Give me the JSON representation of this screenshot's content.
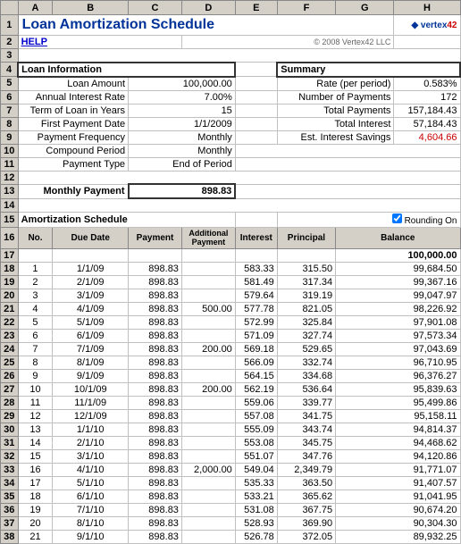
{
  "title": "Loan Amortization Schedule",
  "logo": "© 2008 Vertex42 LLC",
  "help_link": "HELP",
  "loan_info": {
    "header": "Loan Information",
    "fields": [
      {
        "label": "Loan Amount",
        "value": "100,000.00"
      },
      {
        "label": "Annual Interest Rate",
        "value": "7.00%"
      },
      {
        "label": "Term of Loan in Years",
        "value": "15"
      },
      {
        "label": "First Payment Date",
        "value": "1/1/2009"
      },
      {
        "label": "Payment Frequency",
        "value": "Monthly"
      },
      {
        "label": "Compound Period",
        "value": "Monthly"
      },
      {
        "label": "Payment Type",
        "value": "End of Period"
      }
    ]
  },
  "summary": {
    "header": "Summary",
    "fields": [
      {
        "label": "Rate (per period)",
        "value": "0.583%"
      },
      {
        "label": "Number of Payments",
        "value": "172"
      },
      {
        "label": "Total Payments",
        "value": "157,184.43"
      },
      {
        "label": "Total Interest",
        "value": "57,184.43"
      },
      {
        "label": "Est. Interest Savings",
        "value": "4,604.66"
      }
    ]
  },
  "monthly_payment_label": "Monthly Payment",
  "monthly_payment_value": "898.83",
  "rounding_label": "Rounding On",
  "amort_header": "Amortization Schedule",
  "col_headers": [
    "No.",
    "Due Date",
    "Payment",
    "Additional\nPayment",
    "Interest",
    "Principal",
    "Balance"
  ],
  "col_letters": [
    "A",
    "B",
    "C",
    "D",
    "E",
    "F",
    "G",
    "H"
  ],
  "rows": [
    {
      "row": 17,
      "no": "",
      "date": "",
      "payment": "",
      "add_payment": "",
      "interest": "",
      "principal": "",
      "balance": "100,000.00"
    },
    {
      "row": 18,
      "no": "1",
      "date": "1/1/09",
      "payment": "898.83",
      "add_payment": "",
      "interest": "583.33",
      "principal": "315.50",
      "balance": "99,684.50"
    },
    {
      "row": 19,
      "no": "2",
      "date": "2/1/09",
      "payment": "898.83",
      "add_payment": "",
      "interest": "581.49",
      "principal": "317.34",
      "balance": "99,367.16"
    },
    {
      "row": 20,
      "no": "3",
      "date": "3/1/09",
      "payment": "898.83",
      "add_payment": "",
      "interest": "579.64",
      "principal": "319.19",
      "balance": "99,047.97"
    },
    {
      "row": 21,
      "no": "4",
      "date": "4/1/09",
      "payment": "898.83",
      "add_payment": "500.00",
      "interest": "577.78",
      "principal": "821.05",
      "balance": "98,226.92"
    },
    {
      "row": 22,
      "no": "5",
      "date": "5/1/09",
      "payment": "898.83",
      "add_payment": "",
      "interest": "572.99",
      "principal": "325.84",
      "balance": "97,901.08"
    },
    {
      "row": 23,
      "no": "6",
      "date": "6/1/09",
      "payment": "898.83",
      "add_payment": "",
      "interest": "571.09",
      "principal": "327.74",
      "balance": "97,573.34"
    },
    {
      "row": 24,
      "no": "7",
      "date": "7/1/09",
      "payment": "898.83",
      "add_payment": "200.00",
      "interest": "569.18",
      "principal": "529.65",
      "balance": "97,043.69"
    },
    {
      "row": 25,
      "no": "8",
      "date": "8/1/09",
      "payment": "898.83",
      "add_payment": "",
      "interest": "566.09",
      "principal": "332.74",
      "balance": "96,710.95"
    },
    {
      "row": 26,
      "no": "9",
      "date": "9/1/09",
      "payment": "898.83",
      "add_payment": "",
      "interest": "564.15",
      "principal": "334.68",
      "balance": "96,376.27"
    },
    {
      "row": 27,
      "no": "10",
      "date": "10/1/09",
      "payment": "898.83",
      "add_payment": "200.00",
      "interest": "562.19",
      "principal": "536.64",
      "balance": "95,839.63"
    },
    {
      "row": 28,
      "no": "11",
      "date": "11/1/09",
      "payment": "898.83",
      "add_payment": "",
      "interest": "559.06",
      "principal": "339.77",
      "balance": "95,499.86"
    },
    {
      "row": 29,
      "no": "12",
      "date": "12/1/09",
      "payment": "898.83",
      "add_payment": "",
      "interest": "557.08",
      "principal": "341.75",
      "balance": "95,158.11"
    },
    {
      "row": 30,
      "no": "13",
      "date": "1/1/10",
      "payment": "898.83",
      "add_payment": "",
      "interest": "555.09",
      "principal": "343.74",
      "balance": "94,814.37"
    },
    {
      "row": 31,
      "no": "14",
      "date": "2/1/10",
      "payment": "898.83",
      "add_payment": "",
      "interest": "553.08",
      "principal": "345.75",
      "balance": "94,468.62"
    },
    {
      "row": 32,
      "no": "15",
      "date": "3/1/10",
      "payment": "898.83",
      "add_payment": "",
      "interest": "551.07",
      "principal": "347.76",
      "balance": "94,120.86"
    },
    {
      "row": 33,
      "no": "16",
      "date": "4/1/10",
      "payment": "898.83",
      "add_payment": "2,000.00",
      "interest": "549.04",
      "principal": "2,349.79",
      "balance": "91,771.07"
    },
    {
      "row": 34,
      "no": "17",
      "date": "5/1/10",
      "payment": "898.83",
      "add_payment": "",
      "interest": "535.33",
      "principal": "363.50",
      "balance": "91,407.57"
    },
    {
      "row": 35,
      "no": "18",
      "date": "6/1/10",
      "payment": "898.83",
      "add_payment": "",
      "interest": "533.21",
      "principal": "365.62",
      "balance": "91,041.95"
    },
    {
      "row": 36,
      "no": "19",
      "date": "7/1/10",
      "payment": "898.83",
      "add_payment": "",
      "interest": "531.08",
      "principal": "367.75",
      "balance": "90,674.20"
    },
    {
      "row": 37,
      "no": "20",
      "date": "8/1/10",
      "payment": "898.83",
      "add_payment": "",
      "interest": "528.93",
      "principal": "369.90",
      "balance": "90,304.30"
    },
    {
      "row": 38,
      "no": "21",
      "date": "9/1/10",
      "payment": "898.83",
      "add_payment": "",
      "interest": "526.78",
      "principal": "372.05",
      "balance": "89,932.25"
    }
  ]
}
